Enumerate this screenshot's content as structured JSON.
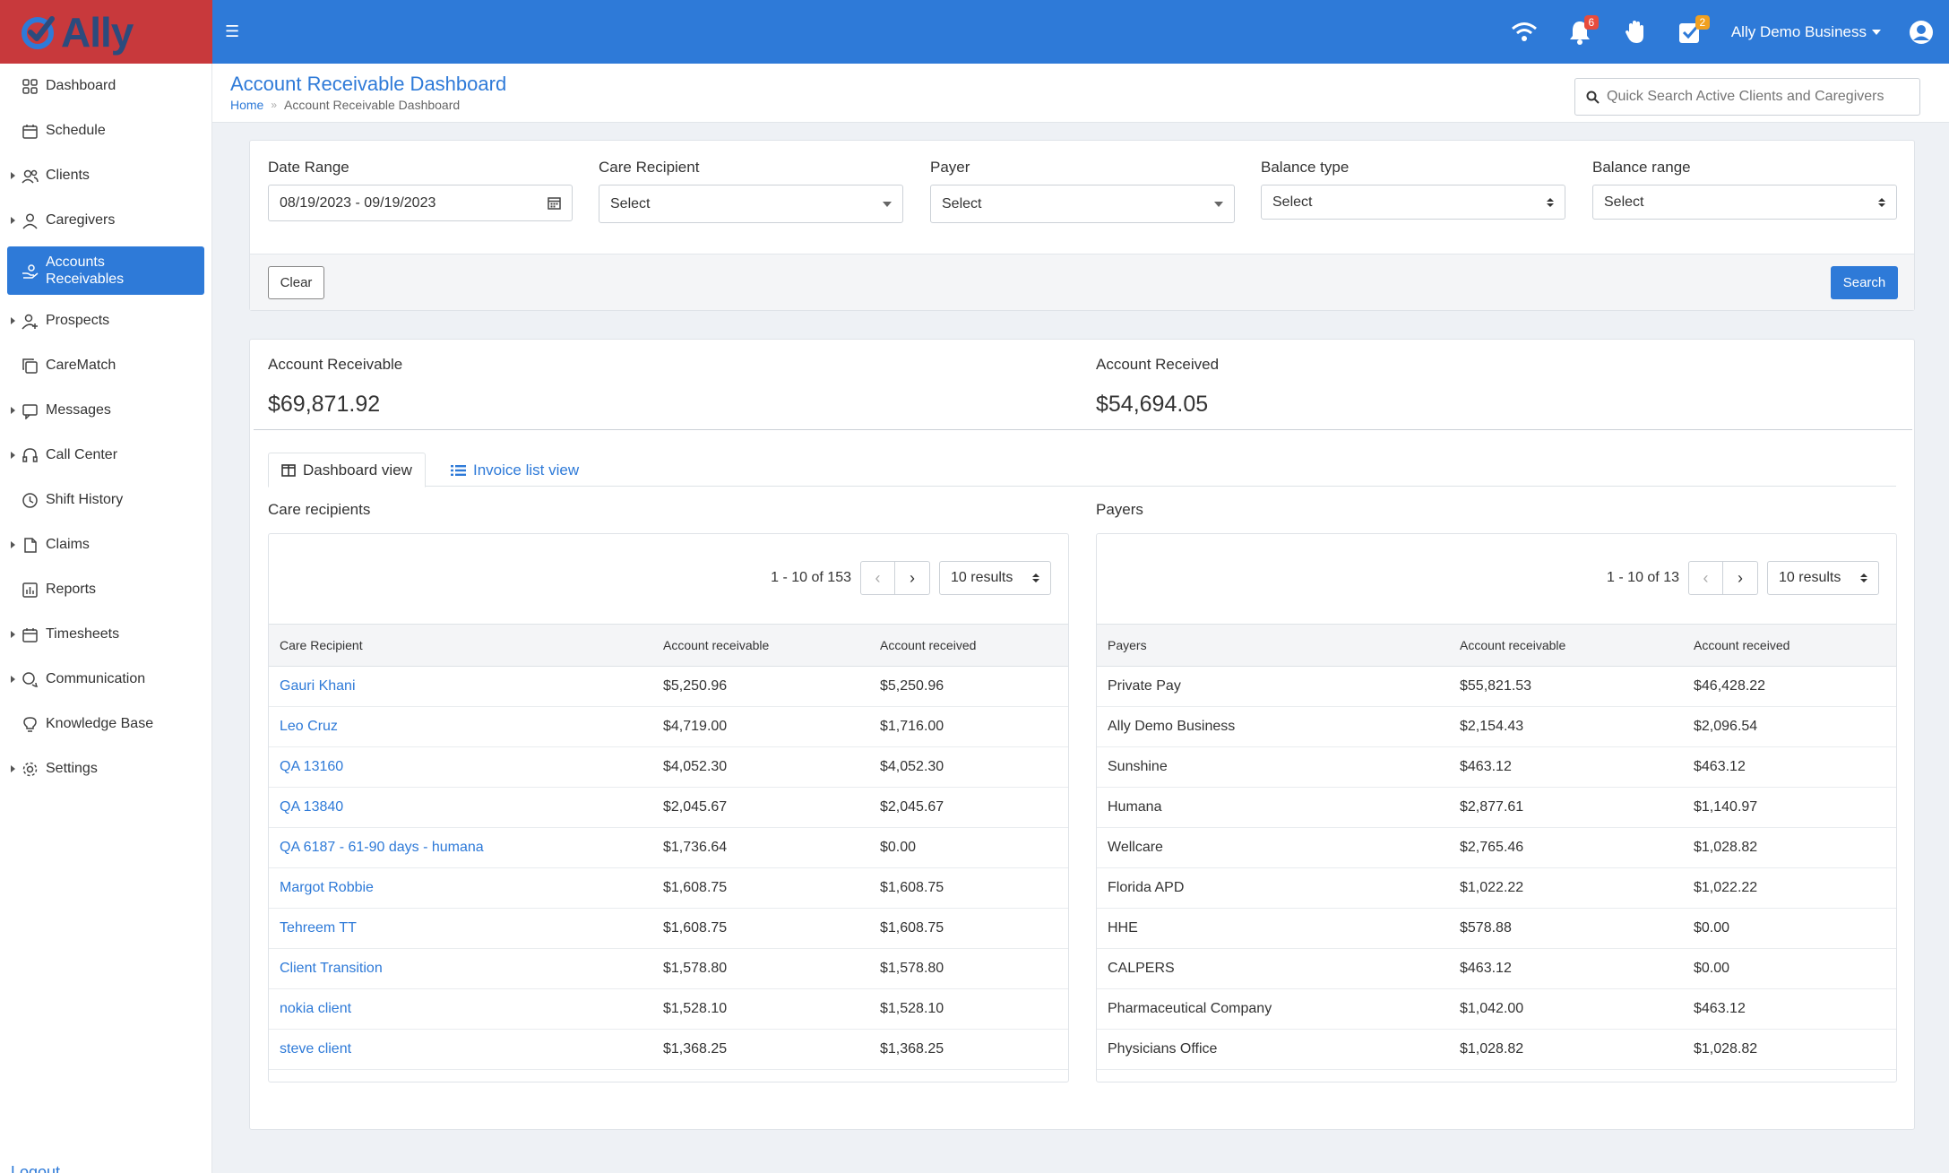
{
  "app": {
    "name": "Ally"
  },
  "topbar": {
    "notifications_count": "6",
    "tasks_count": "2",
    "user_name": "Ally Demo Business"
  },
  "sidebar": {
    "items": [
      {
        "label": "Dashboard",
        "icon": "grid-icon",
        "expandable": false
      },
      {
        "label": "Schedule",
        "icon": "calendar-icon",
        "expandable": false
      },
      {
        "label": "Clients",
        "icon": "users-icon",
        "expandable": true
      },
      {
        "label": "Caregivers",
        "icon": "user-icon",
        "expandable": true
      },
      {
        "label": "Accounts Receivables",
        "icon": "hand-coins-icon",
        "expandable": false,
        "active": true
      },
      {
        "label": "Prospects",
        "icon": "user-plus-icon",
        "expandable": true
      },
      {
        "label": "CareMatch",
        "icon": "copy-icon",
        "expandable": false
      },
      {
        "label": "Messages",
        "icon": "message-icon",
        "expandable": true
      },
      {
        "label": "Call Center",
        "icon": "headset-icon",
        "expandable": true
      },
      {
        "label": "Shift History",
        "icon": "clock-icon",
        "expandable": false
      },
      {
        "label": "Claims",
        "icon": "file-icon",
        "expandable": true
      },
      {
        "label": "Reports",
        "icon": "bar-chart-icon",
        "expandable": false
      },
      {
        "label": "Timesheets",
        "icon": "calendar-icon",
        "expandable": true
      },
      {
        "label": "Communication",
        "icon": "chat-icon",
        "expandable": true
      },
      {
        "label": "Knowledge Base",
        "icon": "lightbulb-icon",
        "expandable": false
      },
      {
        "label": "Settings",
        "icon": "gear-icon",
        "expandable": true
      }
    ],
    "logout_label": "Logout"
  },
  "header": {
    "title": "Account Receivable Dashboard",
    "breadcrumb": {
      "home": "Home",
      "separator": "»",
      "current": "Account Receivable Dashboard"
    },
    "search_placeholder": "Quick Search Active Clients and Caregivers"
  },
  "filters": {
    "date_range": {
      "label": "Date Range",
      "value": "08/19/2023 - 09/19/2023"
    },
    "care_recipient": {
      "label": "Care Recipient",
      "value": "Select"
    },
    "payer": {
      "label": "Payer",
      "value": "Select"
    },
    "balance_type": {
      "label": "Balance type",
      "value": "Select"
    },
    "balance_range": {
      "label": "Balance range",
      "value": "Select"
    },
    "clear_label": "Clear",
    "search_label": "Search"
  },
  "summary": {
    "receivable_label": "Account Receivable",
    "receivable_value": "$69,871.92",
    "received_label": "Account Received",
    "received_value": "$54,694.05"
  },
  "tabs": {
    "dashboard_view": "Dashboard view",
    "invoice_list_view": "Invoice list view"
  },
  "care_recipients": {
    "title": "Care recipients",
    "pager_text": "1 - 10 of 153",
    "results_label": "10 results",
    "columns": [
      "Care Recipient",
      "Account receivable",
      "Account received"
    ],
    "rows": [
      [
        "Gauri Khani",
        "$5,250.96",
        "$5,250.96"
      ],
      [
        "Leo Cruz",
        "$4,719.00",
        "$1,716.00"
      ],
      [
        "QA 13160",
        "$4,052.30",
        "$4,052.30"
      ],
      [
        "QA 13840",
        "$2,045.67",
        "$2,045.67"
      ],
      [
        "QA 6187 - 61-90 days - humana",
        "$1,736.64",
        "$0.00"
      ],
      [
        "Margot Robbie",
        "$1,608.75",
        "$1,608.75"
      ],
      [
        "Tehreem TT",
        "$1,608.75",
        "$1,608.75"
      ],
      [
        "Client Transition",
        "$1,578.80",
        "$1,578.80"
      ],
      [
        "nokia client",
        "$1,528.10",
        "$1,528.10"
      ],
      [
        "steve client",
        "$1,368.25",
        "$1,368.25"
      ]
    ]
  },
  "payers": {
    "title": "Payers",
    "pager_text": "1 - 10 of 13",
    "results_label": "10 results",
    "columns": [
      "Payers",
      "Account receivable",
      "Account received"
    ],
    "rows": [
      [
        "Private Pay",
        "$55,821.53",
        "$46,428.22"
      ],
      [
        "Ally Demo Business",
        "$2,154.43",
        "$2,096.54"
      ],
      [
        "Sunshine",
        "$463.12",
        "$463.12"
      ],
      [
        "Humana",
        "$2,877.61",
        "$1,140.97"
      ],
      [
        "Wellcare",
        "$2,765.46",
        "$1,028.82"
      ],
      [
        "Florida APD",
        "$1,022.22",
        "$1,022.22"
      ],
      [
        "HHE",
        "$578.88",
        "$0.00"
      ],
      [
        "CALPERS",
        "$463.12",
        "$0.00"
      ],
      [
        "Pharmaceutical Company",
        "$1,042.00",
        "$463.12"
      ],
      [
        "Physicians Office",
        "$1,028.82",
        "$1,028.82"
      ]
    ]
  },
  "colors": {
    "primary": "#2e7ad8",
    "logo_bg": "#c8393c",
    "badge_red": "#e74c3c",
    "badge_orange": "#f0a020"
  }
}
